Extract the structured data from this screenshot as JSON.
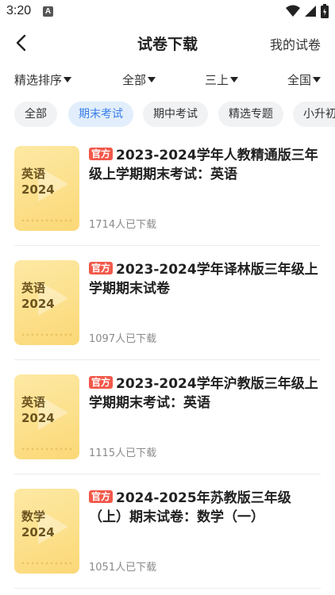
{
  "status_bar": {
    "time": "3:20",
    "a_icon": "A"
  },
  "header": {
    "title": "试卷下载",
    "my_papers": "我的试卷"
  },
  "filters": [
    {
      "label": "精选排序"
    },
    {
      "label": "全部"
    },
    {
      "label": "三上"
    },
    {
      "label": "全国"
    }
  ],
  "chips": [
    {
      "label": "全部"
    },
    {
      "label": "期末考试"
    },
    {
      "label": "期中考试"
    },
    {
      "label": "精选专题"
    },
    {
      "label": "小升初"
    }
  ],
  "official_badge": "官方",
  "papers": [
    {
      "subject": "英语",
      "year": "2024",
      "title": "2023-2024学年人教精通版三年级上学期期末考试：英语",
      "downloads": "1714人已下载"
    },
    {
      "subject": "英语",
      "year": "2024",
      "title": "2023-2024学年译林版三年级上学期期末试卷",
      "downloads": "1097人已下载"
    },
    {
      "subject": "英语",
      "year": "2024",
      "title": "2023-2024学年沪教版三年级上学期期末考试：英语",
      "downloads": "1115人已下载"
    },
    {
      "subject": "数学",
      "year": "2024",
      "title": "2024-2025年苏教版三年级（上）期末试卷：数学（一）",
      "downloads": "1051人已下载"
    }
  ],
  "colors": {
    "accent": "#3a7ee8",
    "chip_active_bg": "#e2eefc",
    "badge": "#f2584a",
    "cover": "#fbd877"
  },
  "icons": {
    "back": "chevron-left-icon",
    "wifi": "wifi-icon",
    "signal": "signal-icon",
    "battery": "battery-icon"
  }
}
